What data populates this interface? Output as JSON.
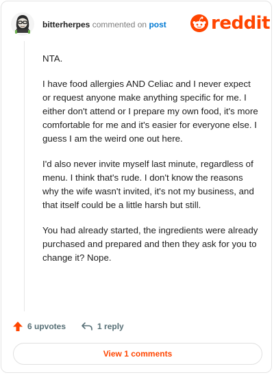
{
  "header": {
    "username": "bitterherpes",
    "verb": "commented on",
    "post_link": "post"
  },
  "brand": {
    "name": "reddit",
    "color": "#ff4500",
    "icon": "snoo-icon"
  },
  "comment": {
    "paragraphs": [
      "NTA.",
      "I have food allergies AND Celiac and I never expect or request anyone make anything specific for me. I either don't attend or I prepare my own food, it's more comfortable for me and it's easier for everyone else. I guess I am the weird one out here.",
      "I'd also never invite myself last minute, regardless of menu. I think that's rude. I don't know the reasons why the wife wasn't invited, it's not my business, and that itself could be a little harsh but still.",
      "You had already started, the ingredients were already purchased and prepared and then they ask for you to change it? Nope."
    ]
  },
  "actions": {
    "upvotes_label": "6 upvotes",
    "upvote_icon": "upvote-arrow-icon",
    "reply_label": "1 reply",
    "reply_icon": "reply-arrow-icon"
  },
  "footer": {
    "view_comments_label": "View 1 comments"
  }
}
